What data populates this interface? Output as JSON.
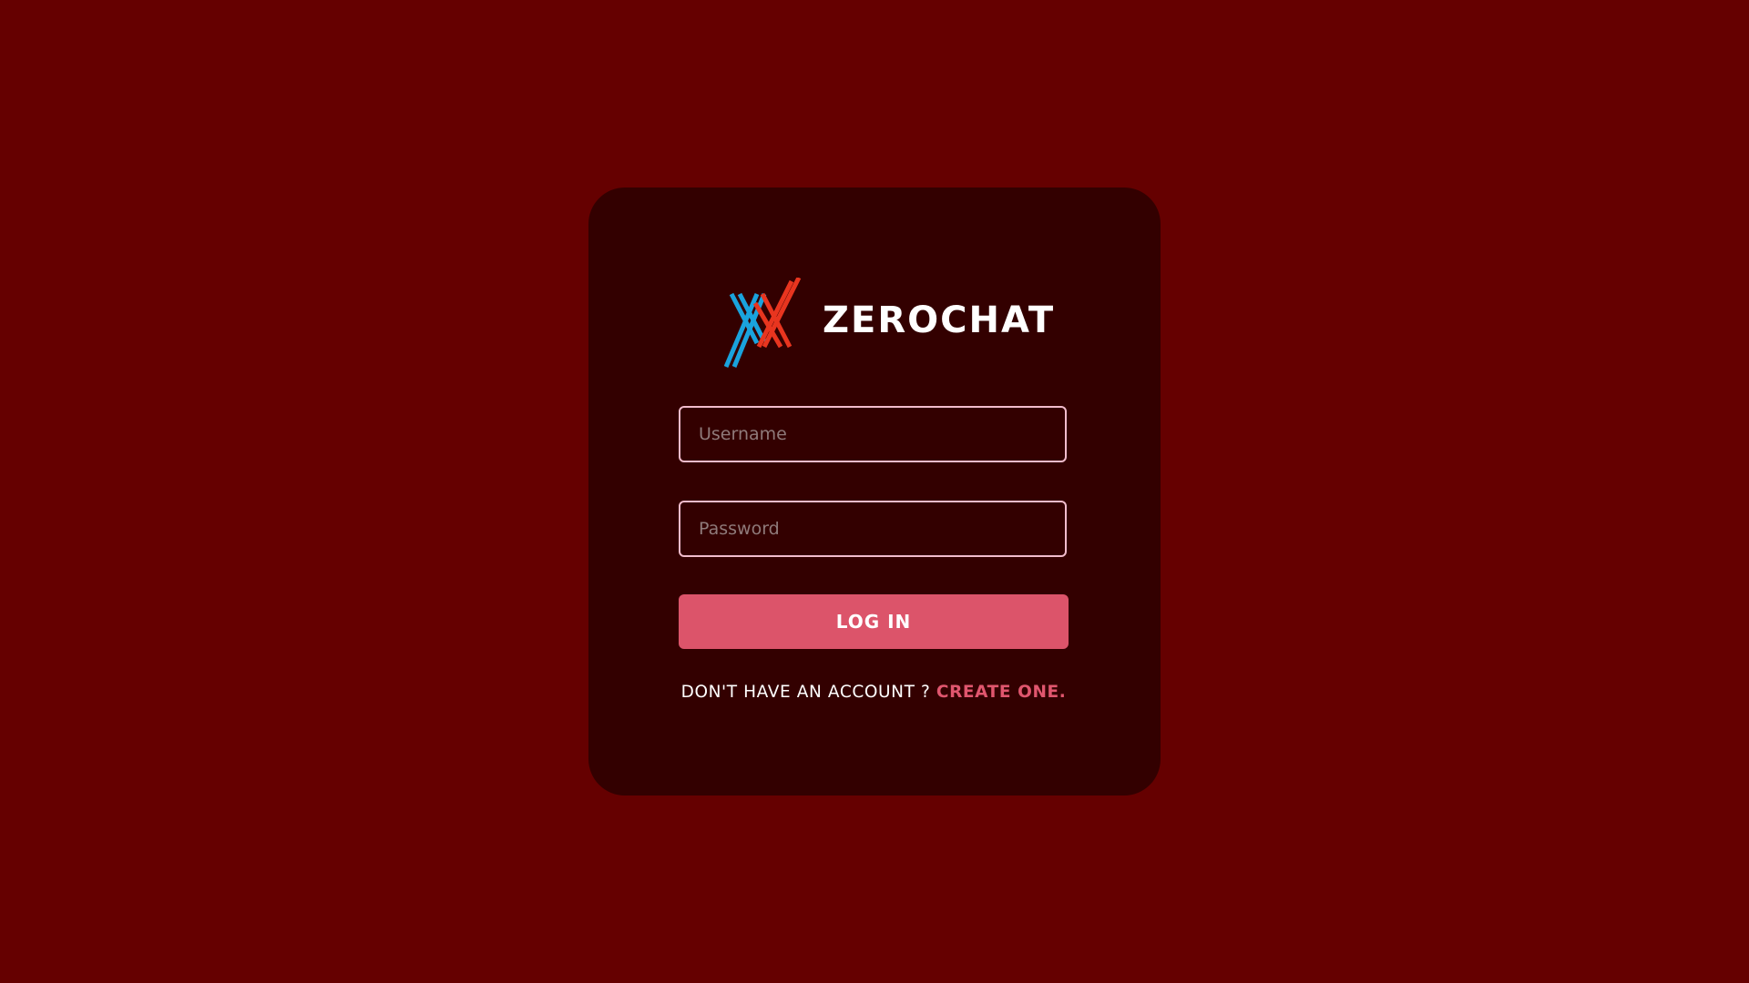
{
  "brand": {
    "name": "ZEROCHAT",
    "logo_icon": "crossed-x-logo-icon",
    "logo_colors": {
      "blue": "#1aa3dd",
      "red": "#e8351f"
    }
  },
  "form": {
    "username_placeholder": "Username",
    "username_value": "",
    "password_placeholder": "Password",
    "password_value": "",
    "login_label": "LOG IN"
  },
  "signup": {
    "prompt": "DON'T HAVE AN ACCOUNT ?",
    "link_label": "CREATE ONE."
  },
  "colors": {
    "page_background": "#650000",
    "card_background": "#330000",
    "accent": "#dc546a",
    "input_border": "#f1bccc"
  }
}
